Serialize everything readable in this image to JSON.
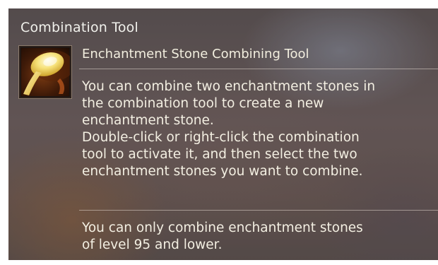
{
  "tooltip": {
    "header": "Combination Tool",
    "item_icon": "spoon-icon",
    "item_name": "Enchantment Stone Combining Tool",
    "description": "You can combine two enchantment stones in\nthe combination tool to create a new\nenchantment stone.\nDouble-click or right-click the combination\ntool to activate it, and then select the two\nenchantment stones you want to combine.",
    "restriction": "You can only combine enchantment stones\nof level 95 and lower."
  }
}
